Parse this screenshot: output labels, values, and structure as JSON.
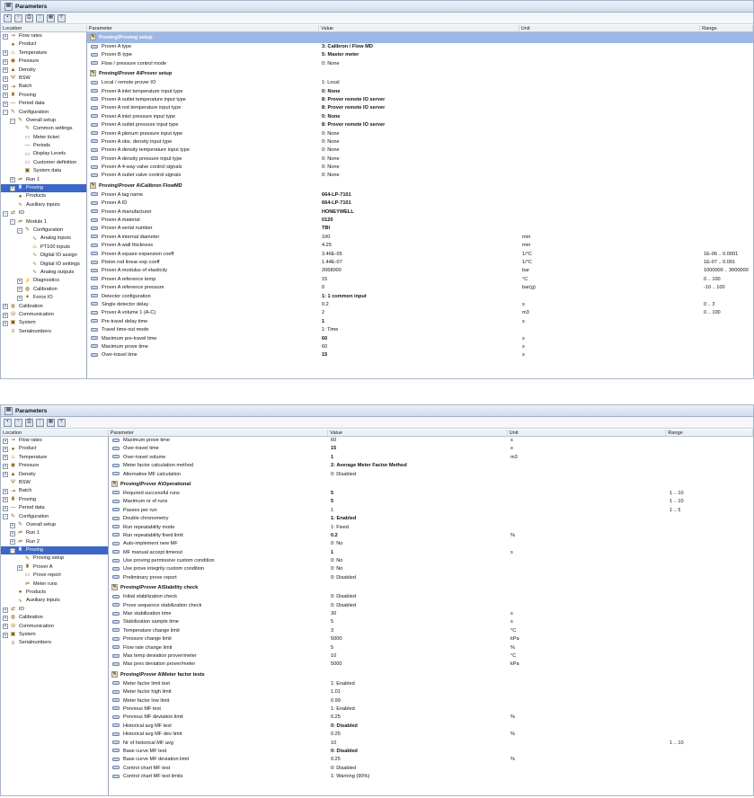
{
  "title": "Parameters",
  "toolbar": [
    "save-icon",
    "save-all-icon",
    "print-icon",
    "tree-icon",
    "grid-icon",
    "filter-icon"
  ],
  "columns": {
    "location": "Location",
    "parameter": "Parameter",
    "value": "Value",
    "unit": "Unit",
    "range": "Range"
  },
  "tree1": [
    {
      "l": "Flow rates",
      "d": 0,
      "t": "+",
      "i": "flow"
    },
    {
      "l": "Product",
      "d": 0,
      "t": "",
      "i": "drop"
    },
    {
      "l": "Temperature",
      "d": 0,
      "t": "+",
      "i": "temp"
    },
    {
      "l": "Pressure",
      "d": 0,
      "t": "+",
      "i": "gauge"
    },
    {
      "l": "Density",
      "d": 0,
      "t": "+",
      "i": "dens"
    },
    {
      "l": "BSW",
      "d": 0,
      "t": "+",
      "i": "bsw"
    },
    {
      "l": "Batch",
      "d": 0,
      "t": "+",
      "i": "batch"
    },
    {
      "l": "Proving",
      "d": 0,
      "t": "+",
      "i": "prove"
    },
    {
      "l": "Period data",
      "d": 0,
      "t": "+",
      "i": "period"
    },
    {
      "l": "Configuration",
      "d": 0,
      "t": "-",
      "i": "config"
    },
    {
      "l": "Overall setup",
      "d": 1,
      "t": "-",
      "i": "config"
    },
    {
      "l": "Common settings",
      "d": 2,
      "t": "",
      "i": "config"
    },
    {
      "l": "Meter ticket",
      "d": 2,
      "t": "",
      "i": "doc"
    },
    {
      "l": "Periods",
      "d": 2,
      "t": "",
      "i": "period"
    },
    {
      "l": "Display Levels",
      "d": 2,
      "t": "",
      "i": "doc"
    },
    {
      "l": "Customer definition",
      "d": 2,
      "t": "",
      "i": "doc"
    },
    {
      "l": "System data",
      "d": 2,
      "t": "",
      "i": "sys"
    },
    {
      "l": "Run 1",
      "d": 1,
      "t": "+",
      "i": "run"
    },
    {
      "l": "Proving",
      "d": 1,
      "t": "+",
      "i": "prove",
      "sel": true
    },
    {
      "l": "Products",
      "d": 1,
      "t": "",
      "i": "drop"
    },
    {
      "l": "Auxiliary inputs",
      "d": 1,
      "t": "",
      "i": "wave"
    },
    {
      "l": "IO",
      "d": 0,
      "t": "-",
      "i": "io"
    },
    {
      "l": "Module 1",
      "d": 1,
      "t": "-",
      "i": "run"
    },
    {
      "l": "Configuration",
      "d": 2,
      "t": "-",
      "i": "config"
    },
    {
      "l": "Analog inputs",
      "d": 3,
      "t": "",
      "i": "wave"
    },
    {
      "l": "PT100 inputs",
      "d": 3,
      "t": "",
      "i": "temp"
    },
    {
      "l": "Digital IO assign",
      "d": 3,
      "t": "",
      "i": "wave"
    },
    {
      "l": "Digital IO settings",
      "d": 3,
      "t": "",
      "i": "wave"
    },
    {
      "l": "Analog outputs",
      "d": 3,
      "t": "",
      "i": "wave"
    },
    {
      "l": "Diagnostics",
      "d": 2,
      "t": "+",
      "i": "diag"
    },
    {
      "l": "Calibration",
      "d": 2,
      "t": "+",
      "i": "cal"
    },
    {
      "l": "Force IO",
      "d": 2,
      "t": "+",
      "i": "force"
    },
    {
      "l": "Calibration",
      "d": 0,
      "t": "+",
      "i": "cal"
    },
    {
      "l": "Communication",
      "d": 0,
      "t": "+",
      "i": "comm"
    },
    {
      "l": "System",
      "d": 0,
      "t": "+",
      "i": "sys"
    },
    {
      "l": "Serialnumbers",
      "d": 0,
      "t": "",
      "i": "serial"
    }
  ],
  "grid1": [
    {
      "s": "Proving\\Proving setup",
      "hl": true
    },
    {
      "p": "Prover A type",
      "v": "3: Calibron / Flow MD",
      "b": true
    },
    {
      "p": "Prover B type",
      "v": "5: Master meter",
      "b": true
    },
    {
      "p": "Flow / pressure control mode",
      "v": "0: None"
    },
    {
      "s": "Proving\\Prover A\\Prover setup"
    },
    {
      "p": "Local / remote prover IO",
      "v": "1: Local"
    },
    {
      "p": "Prover A inlet temperature input type",
      "v": "0: None",
      "b": true
    },
    {
      "p": "Prover A outlet temperature input type",
      "v": "8: Prover remote IO server",
      "b": true
    },
    {
      "p": "Prover A rod temperature input type",
      "v": "8: Prover remote IO server",
      "b": true
    },
    {
      "p": "Prover A inlet pressure input type",
      "v": "0: None",
      "b": true
    },
    {
      "p": "Prover A outlet pressure input type",
      "v": "8: Prover remote IO server",
      "b": true
    },
    {
      "p": "Prover A plenum pressure input type",
      "v": "0: None"
    },
    {
      "p": "Prover A obs. density input type",
      "v": "0: None"
    },
    {
      "p": "Prover A density temperature input type",
      "v": "0: None"
    },
    {
      "p": "Prover A density pressure input type",
      "v": "0: None"
    },
    {
      "p": "Prover A 4-way valve control signals",
      "v": "0: None"
    },
    {
      "p": "Prover A outlet valve control signals",
      "v": "0: None"
    },
    {
      "s": "Proving\\Prover A\\Calibron FlowMD"
    },
    {
      "p": "Prover A tag name",
      "v": "664-LP-7101",
      "b": true
    },
    {
      "p": "Prover A ID",
      "v": "664-LP-7101",
      "b": true
    },
    {
      "p": "Prover A manufacturer",
      "v": "HONEYWELL",
      "b": true
    },
    {
      "p": "Prover A material",
      "v": "0120",
      "b": true
    },
    {
      "p": "Prover A serial number",
      "v": "TBI",
      "b": true
    },
    {
      "p": "Prover A internal diameter",
      "v": "100",
      "u": "mm"
    },
    {
      "p": "Prover A wall thickness",
      "v": "4.25",
      "u": "mm"
    },
    {
      "p": "Prover A square expansion coeff",
      "v": "3.46E-05",
      "u": "1/°C",
      "r": "1E-06 .. 0.0001"
    },
    {
      "p": "Piston rod linear exp coeff",
      "v": "1.44E-07",
      "u": "1/°C",
      "r": "1E-07 .. 0.001"
    },
    {
      "p": "Prover A modulus of elasticity",
      "v": "2068000",
      "u": "bar",
      "r": "1000000 .. 3000000"
    },
    {
      "p": "Prover A reference temp",
      "v": "15",
      "u": "°C",
      "r": "0 .. 100"
    },
    {
      "p": "Prover A reference pressure",
      "v": "0",
      "u": "bar(g)",
      "r": "-10 .. 100"
    },
    {
      "p": "Detector configuration",
      "v": "1: 1 common input",
      "b": true
    },
    {
      "p": "Single detector delay",
      "v": "0.2",
      "u": "s",
      "r": "0 .. 3"
    },
    {
      "p": "Prover A volume 1 (A-C)",
      "v": "2",
      "u": "m3",
      "r": "0 .. 100"
    },
    {
      "p": "Pre-travel delay time",
      "v": "1",
      "u": "s",
      "b": true
    },
    {
      "p": "Travel time-out mode",
      "v": "1: Time"
    },
    {
      "p": "Maximum pre-travel time",
      "v": "60",
      "u": "s",
      "b": true
    },
    {
      "p": "Maximum prove time",
      "v": "60",
      "u": "s"
    },
    {
      "p": "Over-travel time",
      "v": "15",
      "u": "s",
      "b": true
    }
  ],
  "tree2": [
    {
      "l": "Flow rates",
      "d": 0,
      "t": "+",
      "i": "flow"
    },
    {
      "l": "Product",
      "d": 0,
      "t": "+",
      "i": "drop"
    },
    {
      "l": "Temperature",
      "d": 0,
      "t": "+",
      "i": "temp"
    },
    {
      "l": "Pressure",
      "d": 0,
      "t": "+",
      "i": "gauge"
    },
    {
      "l": "Density",
      "d": 0,
      "t": "+",
      "i": "dens"
    },
    {
      "l": "BSW",
      "d": 0,
      "t": "",
      "i": "bsw"
    },
    {
      "l": "Batch",
      "d": 0,
      "t": "+",
      "i": "batch"
    },
    {
      "l": "Proving",
      "d": 0,
      "t": "+",
      "i": "prove"
    },
    {
      "l": "Period data",
      "d": 0,
      "t": "+",
      "i": "period"
    },
    {
      "l": "Configuration",
      "d": 0,
      "t": "-",
      "i": "config"
    },
    {
      "l": "Overall setup",
      "d": 1,
      "t": "+",
      "i": "config"
    },
    {
      "l": "Run 1",
      "d": 1,
      "t": "+",
      "i": "run"
    },
    {
      "l": "Run 2",
      "d": 1,
      "t": "+",
      "i": "run"
    },
    {
      "l": "Proving",
      "d": 1,
      "t": "-",
      "i": "prove",
      "sel": true
    },
    {
      "l": "Proving setup",
      "d": 2,
      "t": "",
      "i": "config"
    },
    {
      "l": "Prover A",
      "d": 2,
      "t": "+",
      "i": "prove"
    },
    {
      "l": "Prove report",
      "d": 2,
      "t": "",
      "i": "doc"
    },
    {
      "l": "Meter runs",
      "d": 2,
      "t": "",
      "i": "run"
    },
    {
      "l": "Products",
      "d": 1,
      "t": "",
      "i": "drop"
    },
    {
      "l": "Auxiliary inputs",
      "d": 1,
      "t": "",
      "i": "wave"
    },
    {
      "l": "IO",
      "d": 0,
      "t": "+",
      "i": "io"
    },
    {
      "l": "Calibration",
      "d": 0,
      "t": "+",
      "i": "cal"
    },
    {
      "l": "Communication",
      "d": 0,
      "t": "+",
      "i": "comm"
    },
    {
      "l": "System",
      "d": 0,
      "t": "+",
      "i": "sys"
    },
    {
      "l": "Serialnumbers",
      "d": 0,
      "t": "",
      "i": "serial"
    }
  ],
  "grid2": [
    {
      "p": "Maximum prove time",
      "v": "60",
      "u": "s"
    },
    {
      "p": "Over-travel time",
      "v": "15",
      "u": "s",
      "b": true
    },
    {
      "p": "Over-travel volume",
      "v": "1",
      "u": "m3",
      "b": true
    },
    {
      "p": "Meter factor calculation method",
      "v": "2: Average Meter Factor Method",
      "b": true
    },
    {
      "p": "Alternative MF calculation",
      "v": "0: Disabled"
    },
    {
      "s": "Proving\\Prover A\\Operational"
    },
    {
      "p": "Required successful runs",
      "v": "5",
      "r": "1 .. 10",
      "b": true
    },
    {
      "p": "Maximum nr of runs",
      "v": "5",
      "r": "1 .. 10",
      "b": true
    },
    {
      "p": "Passes per run",
      "v": "1",
      "r": "1 .. 5"
    },
    {
      "p": "Double chronometry",
      "v": "1: Enabled",
      "b": true
    },
    {
      "p": "Run repeatability mode",
      "v": "1: Fixed"
    },
    {
      "p": "Run repeatability fixed limit",
      "v": "0.2",
      "u": "%",
      "b": true
    },
    {
      "p": "Auto-implement new MF",
      "v": "0: No"
    },
    {
      "p": "MF manual accept timeout",
      "v": "1",
      "u": "s",
      "b": true
    },
    {
      "p": "Use proving permissive custom condition",
      "v": "0: No"
    },
    {
      "p": "Use prove integrity custom condition",
      "v": "0: No"
    },
    {
      "p": "Preliminary prove report",
      "v": "0: Disabled"
    },
    {
      "s": "Proving\\Prover A\\Stability check"
    },
    {
      "p": "Initial stabilization check",
      "v": "0: Disabled"
    },
    {
      "p": "Prove sequence stabilization check",
      "v": "0: Disabled"
    },
    {
      "p": "Max stabilization time",
      "v": "30",
      "u": "s"
    },
    {
      "p": "Stabilization sample time",
      "v": "5",
      "u": "s"
    },
    {
      "p": "Temperature change limit",
      "v": "3",
      "u": "°C"
    },
    {
      "p": "Pressure change limit",
      "v": "5000",
      "u": "kPa"
    },
    {
      "p": "Flow rate change limit",
      "v": "5",
      "u": "%"
    },
    {
      "p": "Max temp deviation prover/meter",
      "v": "10",
      "u": "°C"
    },
    {
      "p": "Max pres deviation prover/meter",
      "v": "5000",
      "u": "kPa"
    },
    {
      "s": "Proving\\Prover A\\Meter factor tests"
    },
    {
      "p": "Meter factor limit test",
      "v": "1: Enabled"
    },
    {
      "p": "Meter factor high limit",
      "v": "1.01"
    },
    {
      "p": "Meter factor low limit",
      "v": "0.99"
    },
    {
      "p": "Previous MF test",
      "v": "1: Enabled"
    },
    {
      "p": "Previous MF deviation limit",
      "v": "0.25",
      "u": "%"
    },
    {
      "p": "Historical avg MF test",
      "v": "0: Disabled",
      "b": true
    },
    {
      "p": "Historical avg MF dev limit",
      "v": "0.25",
      "u": "%"
    },
    {
      "p": "Nr of historical MF avg",
      "v": "10",
      "r": "1 .. 10"
    },
    {
      "p": "Base curve MF test",
      "v": "0: Disabled",
      "b": true
    },
    {
      "p": "Base curve MF deviation limit",
      "v": "0.25",
      "u": "%"
    },
    {
      "p": "Control chart MF test",
      "v": "0: Disabled"
    },
    {
      "p": "Control chart MF test limits",
      "v": "1: Warning (90%)"
    }
  ]
}
